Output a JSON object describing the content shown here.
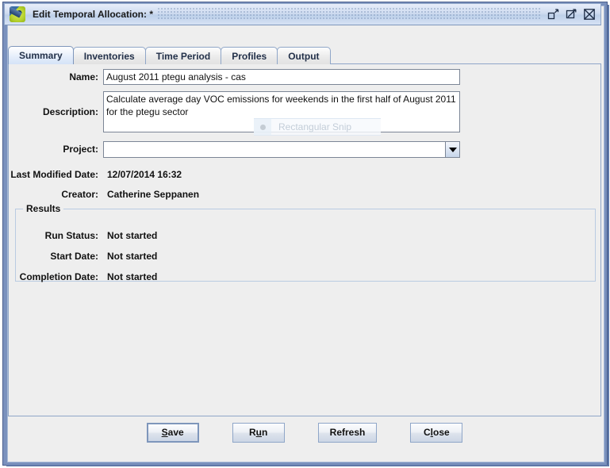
{
  "window": {
    "title": "Edit Temporal Allocation: *",
    "app_icon": "emissions-app-icon",
    "controls": [
      {
        "name": "restore-button",
        "icon": "restore-down-icon"
      },
      {
        "name": "maximize-button",
        "icon": "maximize-icon"
      },
      {
        "name": "close-button",
        "icon": "close-icon"
      }
    ]
  },
  "tabs": [
    {
      "label": "Summary",
      "active": true
    },
    {
      "label": "Inventories",
      "active": false
    },
    {
      "label": "Time Period",
      "active": false
    },
    {
      "label": "Profiles",
      "active": false
    },
    {
      "label": "Output",
      "active": false
    }
  ],
  "form": {
    "name_label": "Name:",
    "name_value": "August 2011 ptegu analysis - cas",
    "description_label": "Description:",
    "description_value": "Calculate average day VOC emissions for weekends in the first half of August 2011 for the ptegu sector",
    "project_label": "Project:",
    "project_value": "",
    "last_modified_label": "Last Modified Date:",
    "last_modified_value": "12/07/2014 16:32",
    "creator_label": "Creator:",
    "creator_value": "Catherine Seppanen"
  },
  "results": {
    "legend": "Results",
    "rows": [
      {
        "label": "Run Status:",
        "value": "Not started"
      },
      {
        "label": "Start Date:",
        "value": "Not started"
      },
      {
        "label": "Completion Date:",
        "value": "Not started"
      }
    ]
  },
  "overlay": {
    "snip_label": "Rectangular Snip"
  },
  "buttons": [
    {
      "name": "save-button",
      "prefix": "",
      "mnemonic": "S",
      "suffix": "ave",
      "default": true
    },
    {
      "name": "run-button",
      "prefix": "R",
      "mnemonic": "u",
      "suffix": "n",
      "default": false
    },
    {
      "name": "refresh-button",
      "prefix": "Refresh",
      "mnemonic": "",
      "suffix": "",
      "default": false
    },
    {
      "name": "close-dialog-button",
      "prefix": "C",
      "mnemonic": "l",
      "suffix": "ose",
      "default": false
    }
  ],
  "colors": {
    "frame": "#7a91bd",
    "panel": "#eeeeee",
    "border": "#8fa6c8",
    "tab_active": "#d4e3f7",
    "text": "#111111"
  }
}
